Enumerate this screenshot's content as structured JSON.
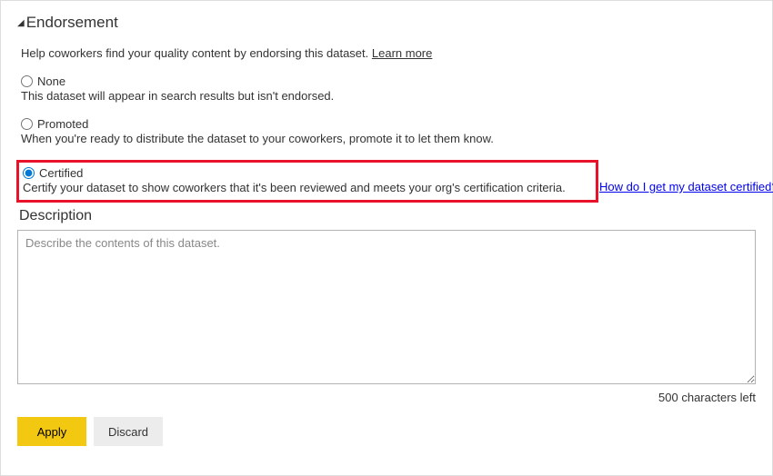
{
  "section": {
    "title": "Endorsement"
  },
  "intro": {
    "text": "Help coworkers find your quality content by endorsing this dataset. ",
    "link": "Learn more"
  },
  "options": {
    "none": {
      "label": "None",
      "description": "This dataset will appear in search results but isn't endorsed."
    },
    "promoted": {
      "label": "Promoted",
      "description": "When you're ready to distribute the dataset to your coworkers, promote it to let them know."
    },
    "certified": {
      "label": "Certified",
      "description": "Certify your dataset to show coworkers that it's been reviewed and meets your org's certification criteria. ",
      "link": "How do I get my dataset certified?"
    }
  },
  "description": {
    "label": "Description",
    "placeholder": "Describe the contents of this dataset.",
    "value": "",
    "char_count": "500 characters left"
  },
  "buttons": {
    "apply": "Apply",
    "discard": "Discard"
  }
}
